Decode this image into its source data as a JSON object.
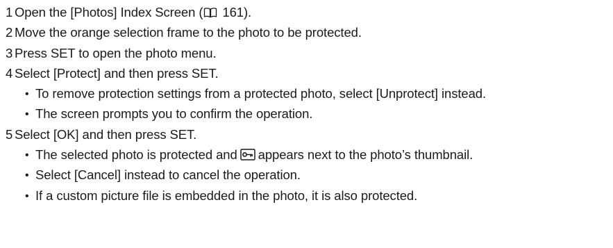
{
  "steps": [
    {
      "number": "1",
      "text_before_icon": "Open the [Photos] Index Screen (",
      "icon": "book-reference-icon",
      "text_after_icon": " 161)."
    },
    {
      "number": "2",
      "text": "Move the orange selection frame to the photo to be protected."
    },
    {
      "number": "3",
      "text": "Press SET to open the photo menu."
    },
    {
      "number": "4",
      "text": "Select [Protect] and then press SET.",
      "bullets": [
        "To remove protection settings from a protected photo, select [Unprotect] instead.",
        "The screen prompts you to confirm the operation."
      ]
    },
    {
      "number": "5",
      "text": "Select [OK] and then press SET.",
      "bullets": [
        {
          "text_before_icon": "The selected photo is protected and",
          "icon": "protect-key-icon",
          "text_after_icon": "appears next to the photo’s thumbnail."
        },
        "Select [Cancel] instead to cancel the operation.",
        "If a custom picture file is embedded in the photo, it is also protected."
      ]
    }
  ],
  "bullet_glyph": "•"
}
